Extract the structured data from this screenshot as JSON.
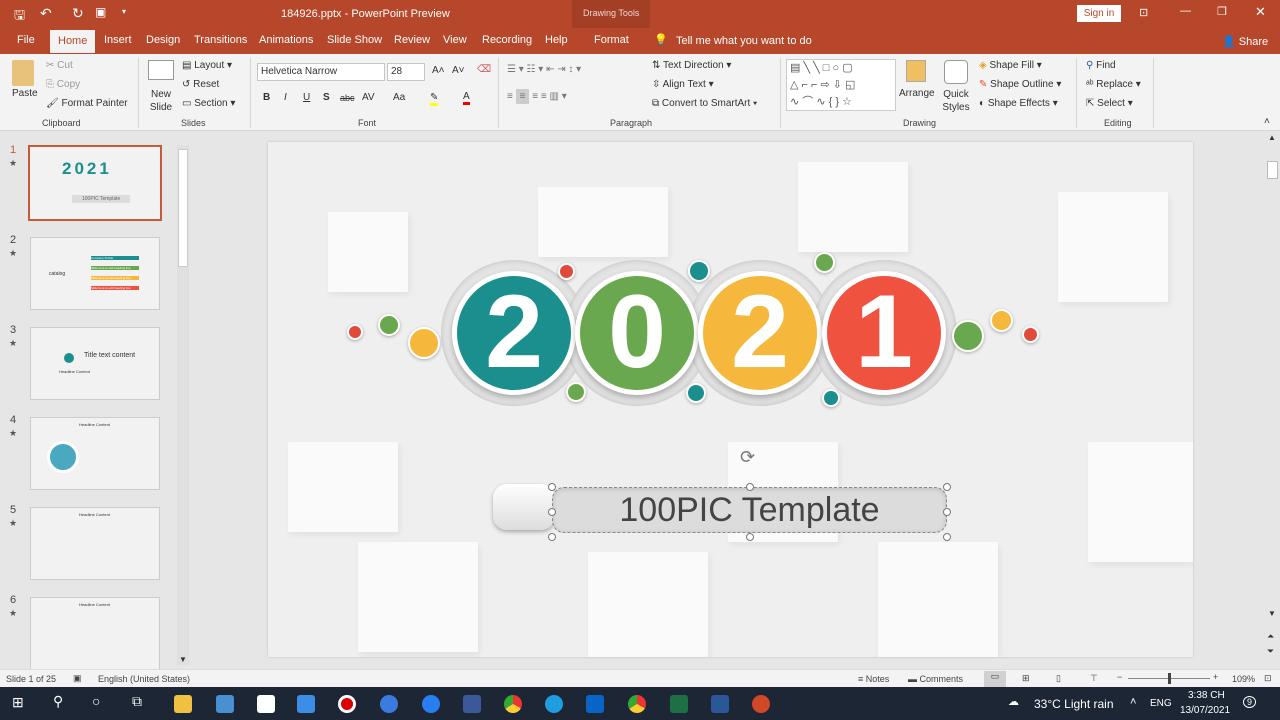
{
  "window": {
    "title": "184926.pptx  -  PowerPoint Preview",
    "context_tab_group": "Drawing Tools",
    "sign_in": "Sign in"
  },
  "tabs": [
    "File",
    "Home",
    "Insert",
    "Design",
    "Transitions",
    "Animations",
    "Slide Show",
    "Review",
    "View",
    "Recording",
    "Help",
    "Format"
  ],
  "active_tab": "Home",
  "tell_me": "Tell me what you want to do",
  "share": "Share",
  "ribbon": {
    "clipboard": {
      "label": "Clipboard",
      "paste": "Paste",
      "cut": "Cut",
      "copy": "Copy",
      "format_painter": "Format Painter"
    },
    "slides": {
      "label": "Slides",
      "new_slide": "New Slide",
      "layout": "Layout",
      "reset": "Reset",
      "section": "Section"
    },
    "font": {
      "label": "Font",
      "font_name": "Helvetica Narrow",
      "font_size": "28",
      "bold": "B",
      "italic": "I",
      "underline": "U",
      "shadow": "S",
      "strike": "abc",
      "spacing": "AV",
      "case": "Aa",
      "color": "A"
    },
    "paragraph": {
      "label": "Paragraph",
      "text_direction": "Text Direction",
      "align_text": "Align Text",
      "convert_smartart": "Convert to SmartArt"
    },
    "drawing": {
      "label": "Drawing",
      "arrange": "Arrange",
      "quick_styles": "Quick Styles",
      "shape_fill": "Shape Fill",
      "shape_outline": "Shape Outline",
      "shape_effects": "Shape Effects"
    },
    "editing": {
      "label": "Editing",
      "find": "Find",
      "replace": "Replace",
      "select": "Select"
    }
  },
  "thumbnails": [
    {
      "num": "1",
      "texts": [
        "2021",
        "100PIC Template"
      ]
    },
    {
      "num": "2",
      "texts": [
        "catalog",
        "Company Profile",
        "Slide here to edit heading line",
        "Slide here to edit heading line",
        "Slide here to edit heading line"
      ]
    },
    {
      "num": "3",
      "texts": [
        "Title text content",
        "Headline Content"
      ]
    },
    {
      "num": "4",
      "texts": [
        "Headline Content"
      ]
    },
    {
      "num": "5",
      "texts": [
        "Headline Content"
      ]
    },
    {
      "num": "6",
      "texts": [
        "Headline Content"
      ]
    }
  ],
  "slide": {
    "digits": [
      "2",
      "0",
      "2",
      "1"
    ],
    "subtitle": "100PIC Template",
    "colors": {
      "teal": "#1a8f8e",
      "green": "#6aa84f",
      "yellow": "#f5b83d",
      "red": "#ef5340"
    }
  },
  "status": {
    "slide_of": "Slide 1 of 25",
    "language": "English (United States)",
    "notes": "Notes",
    "comments": "Comments",
    "zoom": "109%"
  },
  "taskbar": {
    "weather": "33°C  Light rain",
    "lang": "ENG",
    "time": "3:38 CH",
    "date": "13/07/2021",
    "notif": "9"
  },
  "accent": "#b7472a"
}
